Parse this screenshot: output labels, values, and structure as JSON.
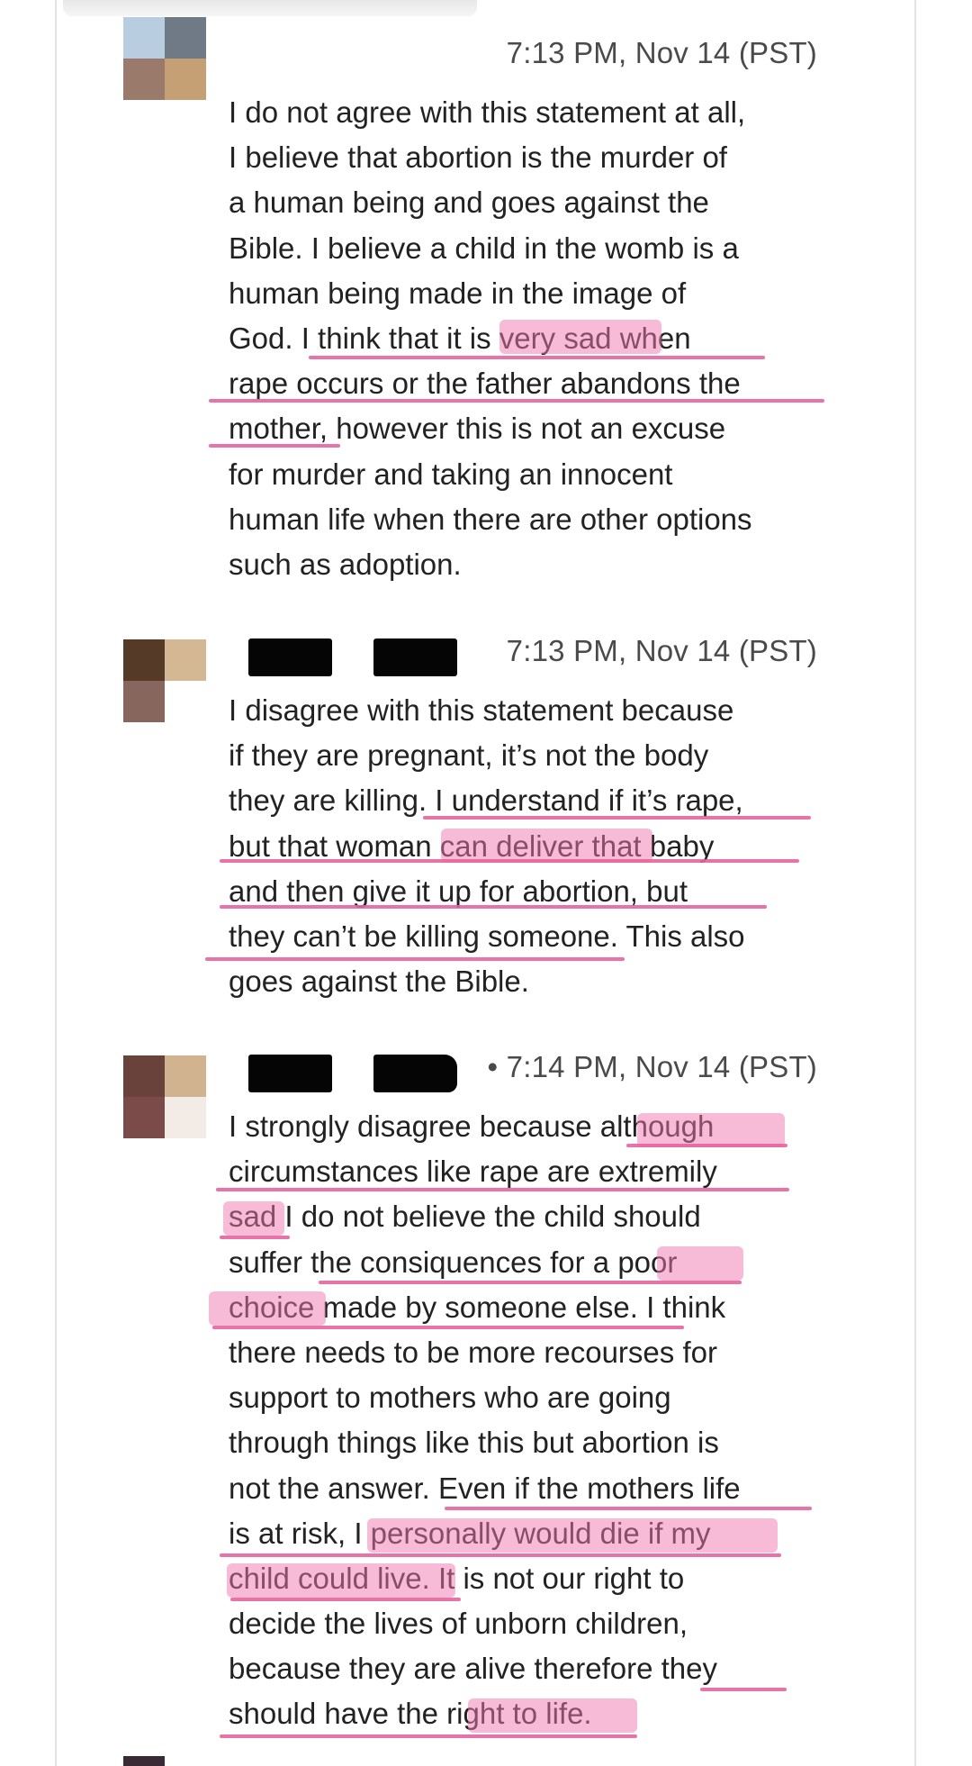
{
  "colors": {
    "highlight": "#f078af",
    "underline": "#e464a0",
    "text": "#222222",
    "timestamp": "#4a4a4a",
    "redaction": "#050505"
  },
  "posts": [
    {
      "timestamp": "7:13 PM, Nov 14 (PST)",
      "author_redacted": true,
      "avatar_colors": [
        "#b9cde0",
        "#6f7a86",
        "#9a7a6a",
        "#c4a074"
      ],
      "lines": [
        "I do not agree with this statement at all,",
        "I believe that abortion is the murder of",
        "a human being and goes against the",
        "Bible. I believe a child in the womb is a",
        "human being made in the image of",
        "God. I think that it is very sad when",
        "rape occurs or the father abandons the",
        "mother, however this is not an excuse",
        "for murder and taking an innocent",
        "human life when there are other options",
        "such as adoption."
      ]
    },
    {
      "timestamp": "7:13 PM, Nov 14 (PST)",
      "author_redacted": true,
      "avatar_colors": [
        "#553a28",
        "#d3b893",
        "#87675d",
        "#ffffff"
      ],
      "lines": [
        "I disagree with this statement because",
        "if they are pregnant, it’s not the body",
        "they are killing. I understand if it’s rape,",
        "but that woman can deliver that baby",
        "and then give it up for abortion, but",
        "they can’t be killing someone. This also",
        "goes against the Bible."
      ]
    },
    {
      "timestamp": "• 7:14 PM, Nov 14 (PST)",
      "author_redacted": true,
      "avatar_colors": [
        "#6a423c",
        "#d1b48f",
        "#7a4b48",
        "#f3ece6"
      ],
      "lines": [
        "I strongly disagree because although",
        "circumstances like rape are extremily",
        "sad I do not believe the child should",
        "suffer the consiquences for a poor",
        "choice made by someone else. I think",
        "there needs to be more recourses for",
        "support to mothers who are going",
        "through things like this but abortion is",
        "not the answer. Even if the mothers life",
        "is at risk, I personally would die if my",
        "child could live. It is not our right to",
        "decide the lives of unborn children,",
        "because they are alive therefore they",
        "should have the right to life."
      ]
    }
  ]
}
